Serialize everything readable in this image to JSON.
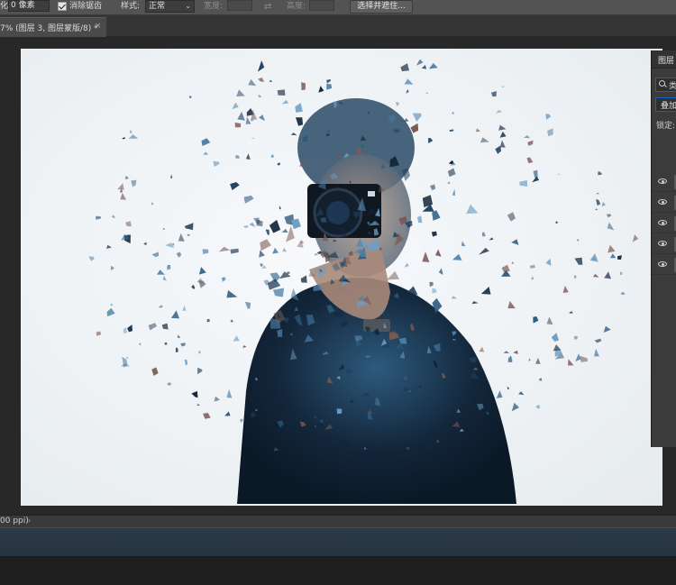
{
  "options_bar": {
    "feather_label": "化:",
    "feather_value": "0 像素",
    "antialias_label": "消除锯齿",
    "style_label": "样式:",
    "style_value": "正常",
    "width_label": "宽度:",
    "height_label": "高度:",
    "mask_button": "选择并遮住..."
  },
  "document_tab": {
    "title": "7% (图层 3, 图层蒙版/8) *",
    "close": "×"
  },
  "layers_panel": {
    "title": "图层",
    "filter_value": "类",
    "blend_mode": "叠加",
    "lock_label": "锁定:",
    "rows": [
      {
        "visible": true
      },
      {
        "visible": true
      },
      {
        "visible": true
      },
      {
        "visible": true
      },
      {
        "visible": true
      }
    ]
  },
  "status_bar": {
    "text": "00 ppi)",
    "arrow": "›"
  },
  "canvas": {
    "accent_dark": "#13263a",
    "accent_blue": "#2d5a7d",
    "background": "#eef2f5"
  }
}
